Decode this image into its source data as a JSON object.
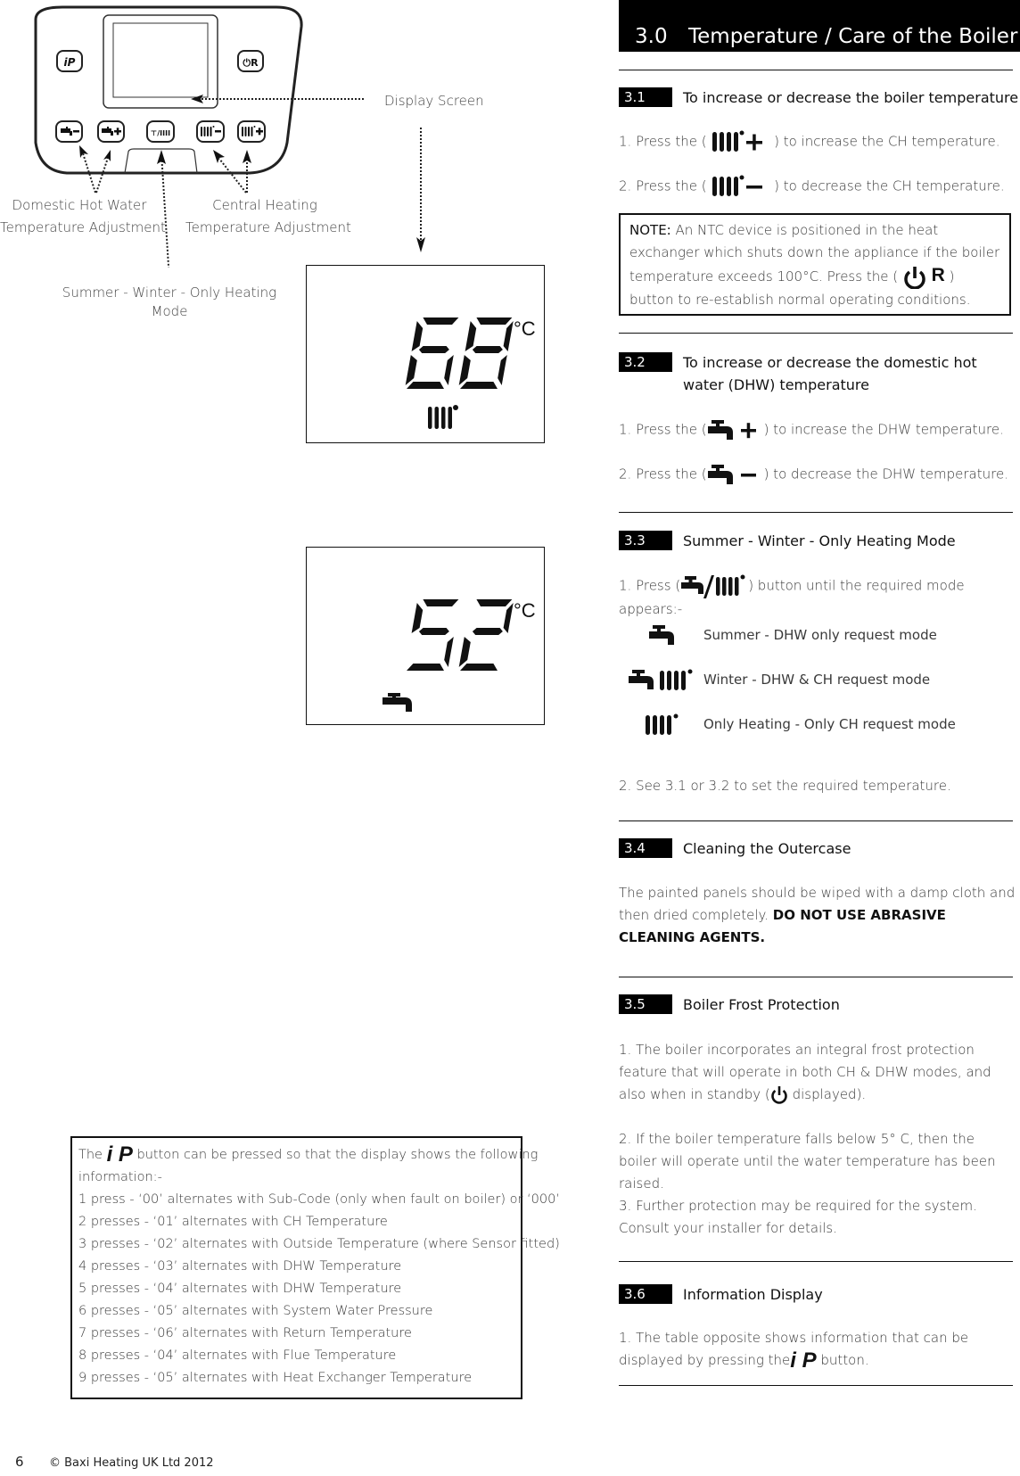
{
  "header": {
    "section_number": "3.0",
    "title": "Temperature / Care of the Boiler"
  },
  "diagram": {
    "panel_buttons": {
      "info": "iP",
      "reset": "⏻R",
      "dhw_minus": "tap-minus",
      "dhw_plus": "tap-plus",
      "mode": "tap/radiator",
      "ch_minus": "radiator-minus",
      "ch_plus": "radiator-plus"
    },
    "labels": {
      "display_screen": "Display Screen",
      "dhw_line1": "Domestic Hot Water",
      "dhw_line2": "Temperature Adjustment",
      "ch_line1": "Central Heating",
      "ch_line2": "Temperature Adjustment",
      "mode_line1": "Summer - Winter - Only Heating",
      "mode_line2": "Mode"
    },
    "lcd_displays": [
      {
        "value": "68",
        "unit": "°C",
        "icon": "radiator-icon"
      },
      {
        "value": "52",
        "unit": "°C",
        "icon": "tap-icon"
      }
    ]
  },
  "info_box": {
    "intro_pre": "The",
    "intro_button": "i P",
    "intro_post": "button can be pressed so that the display shows the following",
    "intro_line2": "information:-",
    "items": [
      "1 press - ‘00’ alternates with Sub-Code (only when fault on boiler) or ‘000’",
      "2 presses - ‘01’ alternates with CH Temperature",
      "3 presses - ‘02’ alternates with Outside Temperature (where Sensor fitted)",
      "4 presses - ‘03’ alternates with DHW Temperature",
      "5 presses - ‘04’ alternates with DHW Temperature",
      "6 presses - ‘05’ alternates with System Water Pressure",
      "7 presses - ‘06’ alternates with Return Temperature",
      "8 presses - ‘04’ alternates with Flue Temperature",
      "9 presses - ‘05’ alternates with Heat Exchanger Temperature"
    ]
  },
  "sections": {
    "s31": {
      "number": "3.1",
      "title": "To increase or decrease the boiler temperature",
      "step1_pre": "1. Press the (",
      "step1_post": ") to increase the CH temperature.",
      "step2_pre": "2. Press the (",
      "step2_post": ") to decrease the CH temperature."
    },
    "note": {
      "label": "NOTE:",
      "text1": "An NTC device is positioned in the heat exchanger which shuts down the appliance if the boiler temperature exceeds 100°C. Press the (",
      "button": "R",
      "text2": ") button to re-establish normal operating conditions."
    },
    "s32": {
      "number": "3.2",
      "title": "To increase or decrease the domestic hot water (DHW) temperature",
      "step1_pre": "1. Press the (",
      "step1_post": ") to increase the DHW temperature.",
      "step2_pre": "2. Press the (",
      "step2_post": ") to decrease the DHW temperature."
    },
    "s33": {
      "number": "3.3",
      "title": "Summer - Winter - Only Heating Mode",
      "step1_pre": "1. Press  (",
      "step1_post": ") button until the required mode appears:-",
      "modes": [
        {
          "icon": "tap-icon",
          "label": "Summer - DHW only request mode"
        },
        {
          "icon": "tap-radiator-icon",
          "label": "Winter - DHW & CH request mode"
        },
        {
          "icon": "radiator-icon",
          "label": "Only Heating - Only CH request mode"
        }
      ],
      "step2": "2. See 3.1 or 3.2 to set the required temperature."
    },
    "s34": {
      "number": "3.4",
      "title": "Cleaning the Outercase",
      "text": "The painted panels should be wiped with a damp cloth and then dried completely.",
      "warning": "DO NOT USE ABRASIVE CLEANING AGENTS."
    },
    "s35": {
      "number": "3.5",
      "title": "Boiler Frost Protection",
      "p1_pre": "1. The boiler incorporates an integral frost protection feature that will operate in both CH & DHW modes, and also when in standby (",
      "p1_post": "displayed).",
      "p2": "2. If the boiler temperature falls below 5° C, then the boiler will operate until the water temperature has been raised.",
      "p3": "3. Further protection may be required for the system. Consult your installer for details."
    },
    "s36": {
      "number": "3.6",
      "title": "Information Display",
      "p1_pre": "1. The table opposite shows information that can be displayed by pressing the",
      "button": "i P",
      "p1_post": "button."
    }
  },
  "footer": {
    "page_number": "6",
    "copyright": "© Baxi Heating UK Ltd 2012"
  }
}
